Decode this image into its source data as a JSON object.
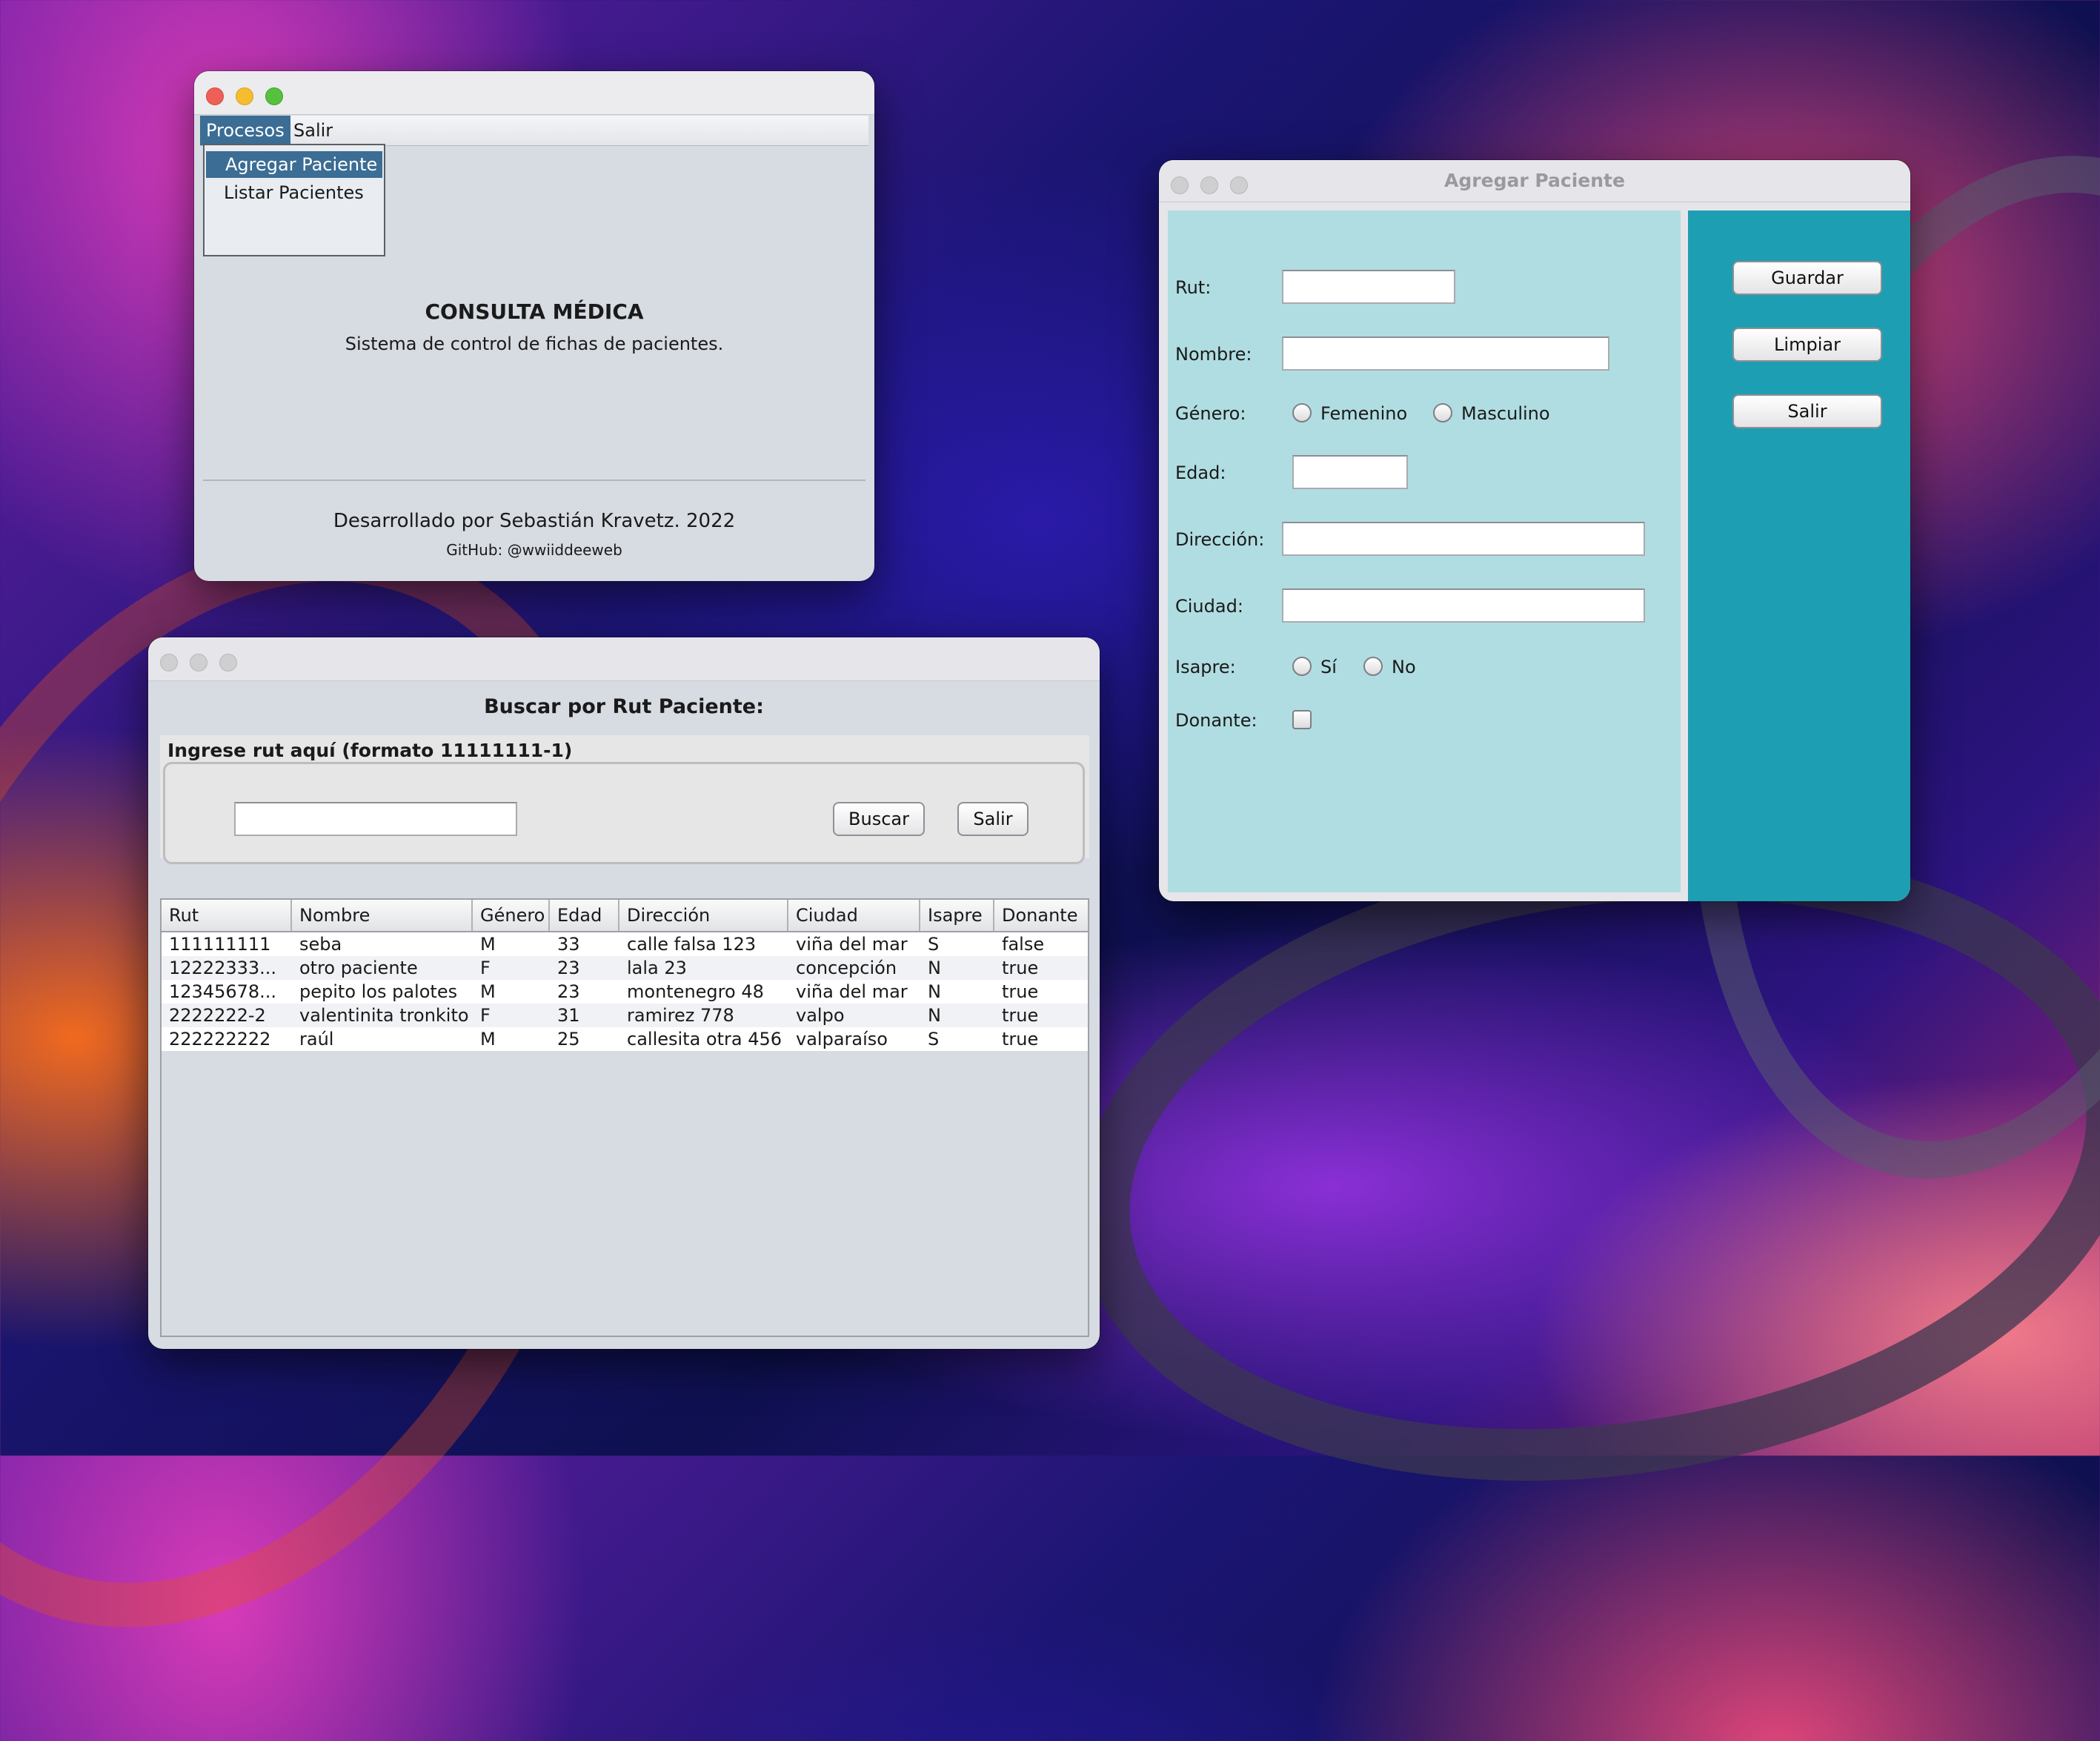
{
  "main_window": {
    "menus": [
      "Procesos",
      "Salir"
    ],
    "dropdown_items": [
      "Agregar Paciente",
      "Listar Pacientes"
    ],
    "title": "CONSULTA MÉDICA",
    "subtitle": "Sistema de control de fichas de pacientes.",
    "credit": "Desarrollado por Sebastián Kravetz. 2022",
    "github": "GitHub: @wwiiddeeweb"
  },
  "search_window": {
    "heading": "Buscar por Rut Paciente:",
    "fieldset_label": "Ingrese rut aquí (formato 11111111-1)",
    "search_value": "",
    "search_button": "Buscar",
    "exit_button": "Salir",
    "table": {
      "columns": [
        "Rut",
        "Nombre",
        "Género",
        "Edad",
        "Dirección",
        "Ciudad",
        "Isapre",
        "Donante"
      ],
      "rows": [
        [
          "111111111",
          "seba",
          "M",
          "33",
          "calle falsa 123",
          "viña del mar",
          "S",
          "false"
        ],
        [
          "12222333...",
          "otro paciente",
          "F",
          "23",
          "lala 23",
          "concepción",
          "N",
          "true"
        ],
        [
          "12345678...",
          "pepito los palotes",
          "M",
          "23",
          "montenegro 48",
          "viña del mar",
          "N",
          "true"
        ],
        [
          "2222222-2",
          "valentinita tronkito",
          "F",
          "31",
          "ramirez 778",
          "valpo",
          "N",
          "true"
        ],
        [
          "222222222",
          "raúl",
          "M",
          "25",
          "callesita otra 456",
          "valparaíso",
          "S",
          "true"
        ]
      ]
    }
  },
  "form_window": {
    "title": "Agregar Paciente",
    "labels": {
      "rut": "Rut:",
      "nombre": "Nombre:",
      "genero": "Género:",
      "edad": "Edad:",
      "direccion": "Dirección:",
      "ciudad": "Ciudad:",
      "isapre": "Isapre:",
      "donante": "Donante:"
    },
    "values": {
      "rut": "",
      "nombre": "",
      "edad": "",
      "direccion": "",
      "ciudad": ""
    },
    "gender_options": [
      "Femenino",
      "Masculino"
    ],
    "isapre_options": [
      "Sí",
      "No"
    ],
    "buttons": [
      "Guardar",
      "Limpiar",
      "Salir"
    ],
    "colors": {
      "form_panel": "#b0dde1",
      "side_panel": "#1e9eb2"
    }
  }
}
